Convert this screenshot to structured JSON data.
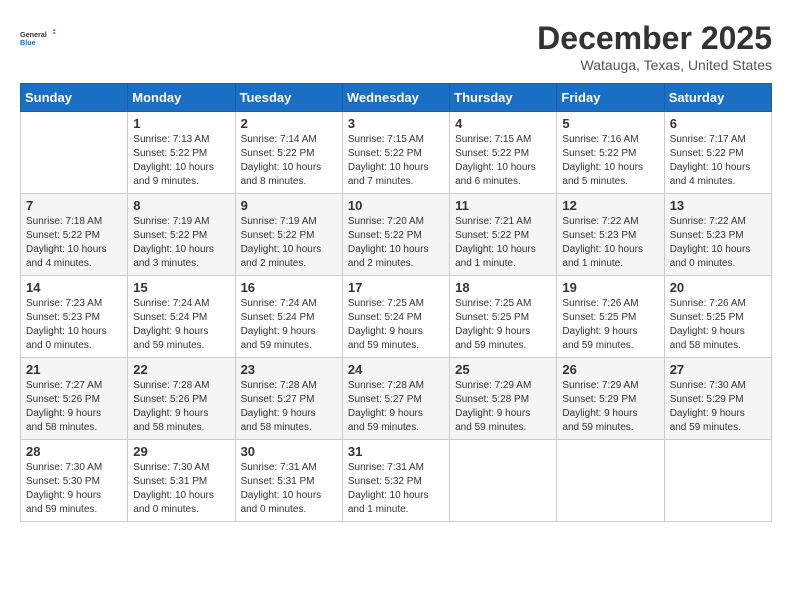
{
  "logo": {
    "line1": "General",
    "line2": "Blue"
  },
  "title": "December 2025",
  "location": "Watauga, Texas, United States",
  "weekdays": [
    "Sunday",
    "Monday",
    "Tuesday",
    "Wednesday",
    "Thursday",
    "Friday",
    "Saturday"
  ],
  "weeks": [
    [
      {
        "day": "",
        "info": ""
      },
      {
        "day": "1",
        "info": "Sunrise: 7:13 AM\nSunset: 5:22 PM\nDaylight: 10 hours\nand 9 minutes."
      },
      {
        "day": "2",
        "info": "Sunrise: 7:14 AM\nSunset: 5:22 PM\nDaylight: 10 hours\nand 8 minutes."
      },
      {
        "day": "3",
        "info": "Sunrise: 7:15 AM\nSunset: 5:22 PM\nDaylight: 10 hours\nand 7 minutes."
      },
      {
        "day": "4",
        "info": "Sunrise: 7:15 AM\nSunset: 5:22 PM\nDaylight: 10 hours\nand 6 minutes."
      },
      {
        "day": "5",
        "info": "Sunrise: 7:16 AM\nSunset: 5:22 PM\nDaylight: 10 hours\nand 5 minutes."
      },
      {
        "day": "6",
        "info": "Sunrise: 7:17 AM\nSunset: 5:22 PM\nDaylight: 10 hours\nand 4 minutes."
      }
    ],
    [
      {
        "day": "7",
        "info": "Sunrise: 7:18 AM\nSunset: 5:22 PM\nDaylight: 10 hours\nand 4 minutes."
      },
      {
        "day": "8",
        "info": "Sunrise: 7:19 AM\nSunset: 5:22 PM\nDaylight: 10 hours\nand 3 minutes."
      },
      {
        "day": "9",
        "info": "Sunrise: 7:19 AM\nSunset: 5:22 PM\nDaylight: 10 hours\nand 2 minutes."
      },
      {
        "day": "10",
        "info": "Sunrise: 7:20 AM\nSunset: 5:22 PM\nDaylight: 10 hours\nand 2 minutes."
      },
      {
        "day": "11",
        "info": "Sunrise: 7:21 AM\nSunset: 5:22 PM\nDaylight: 10 hours\nand 1 minute."
      },
      {
        "day": "12",
        "info": "Sunrise: 7:22 AM\nSunset: 5:23 PM\nDaylight: 10 hours\nand 1 minute."
      },
      {
        "day": "13",
        "info": "Sunrise: 7:22 AM\nSunset: 5:23 PM\nDaylight: 10 hours\nand 0 minutes."
      }
    ],
    [
      {
        "day": "14",
        "info": "Sunrise: 7:23 AM\nSunset: 5:23 PM\nDaylight: 10 hours\nand 0 minutes."
      },
      {
        "day": "15",
        "info": "Sunrise: 7:24 AM\nSunset: 5:24 PM\nDaylight: 9 hours\nand 59 minutes."
      },
      {
        "day": "16",
        "info": "Sunrise: 7:24 AM\nSunset: 5:24 PM\nDaylight: 9 hours\nand 59 minutes."
      },
      {
        "day": "17",
        "info": "Sunrise: 7:25 AM\nSunset: 5:24 PM\nDaylight: 9 hours\nand 59 minutes."
      },
      {
        "day": "18",
        "info": "Sunrise: 7:25 AM\nSunset: 5:25 PM\nDaylight: 9 hours\nand 59 minutes."
      },
      {
        "day": "19",
        "info": "Sunrise: 7:26 AM\nSunset: 5:25 PM\nDaylight: 9 hours\nand 59 minutes."
      },
      {
        "day": "20",
        "info": "Sunrise: 7:26 AM\nSunset: 5:25 PM\nDaylight: 9 hours\nand 58 minutes."
      }
    ],
    [
      {
        "day": "21",
        "info": "Sunrise: 7:27 AM\nSunset: 5:26 PM\nDaylight: 9 hours\nand 58 minutes."
      },
      {
        "day": "22",
        "info": "Sunrise: 7:28 AM\nSunset: 5:26 PM\nDaylight: 9 hours\nand 58 minutes."
      },
      {
        "day": "23",
        "info": "Sunrise: 7:28 AM\nSunset: 5:27 PM\nDaylight: 9 hours\nand 58 minutes."
      },
      {
        "day": "24",
        "info": "Sunrise: 7:28 AM\nSunset: 5:27 PM\nDaylight: 9 hours\nand 59 minutes."
      },
      {
        "day": "25",
        "info": "Sunrise: 7:29 AM\nSunset: 5:28 PM\nDaylight: 9 hours\nand 59 minutes."
      },
      {
        "day": "26",
        "info": "Sunrise: 7:29 AM\nSunset: 5:29 PM\nDaylight: 9 hours\nand 59 minutes."
      },
      {
        "day": "27",
        "info": "Sunrise: 7:30 AM\nSunset: 5:29 PM\nDaylight: 9 hours\nand 59 minutes."
      }
    ],
    [
      {
        "day": "28",
        "info": "Sunrise: 7:30 AM\nSunset: 5:30 PM\nDaylight: 9 hours\nand 59 minutes."
      },
      {
        "day": "29",
        "info": "Sunrise: 7:30 AM\nSunset: 5:31 PM\nDaylight: 10 hours\nand 0 minutes."
      },
      {
        "day": "30",
        "info": "Sunrise: 7:31 AM\nSunset: 5:31 PM\nDaylight: 10 hours\nand 0 minutes."
      },
      {
        "day": "31",
        "info": "Sunrise: 7:31 AM\nSunset: 5:32 PM\nDaylight: 10 hours\nand 1 minute."
      },
      {
        "day": "",
        "info": ""
      },
      {
        "day": "",
        "info": ""
      },
      {
        "day": "",
        "info": ""
      }
    ]
  ]
}
